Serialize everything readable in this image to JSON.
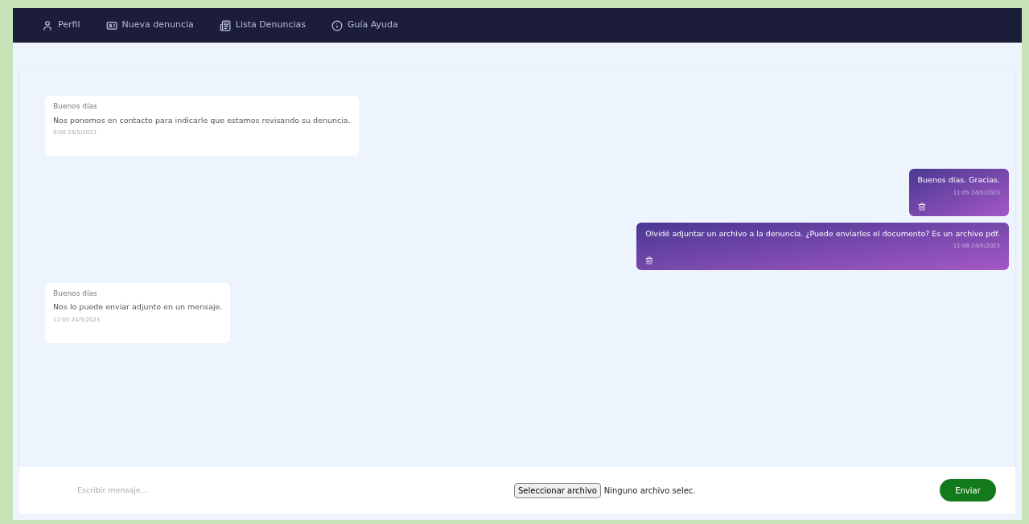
{
  "nav": [
    {
      "label": "Perfil"
    },
    {
      "label": "Nueva denuncia"
    },
    {
      "label": "Lista Denuncias"
    },
    {
      "label": "Guía Ayuda"
    }
  ],
  "messages": [
    {
      "kind": "incoming",
      "greeting": "Buenos días",
      "text": "Nos ponemos en contacto para indicarle que estamos revisando su denuncia.",
      "time": "9:00 24/5/2023"
    },
    {
      "kind": "outgoing",
      "text": "Buenos días. Gracias.",
      "time": "11:05 24/5/2023"
    },
    {
      "kind": "outgoing",
      "text": "Olvidé adjuntar un archivo a la denuncia. ¿Puede enviarles el documento? Es un archivo pdf.",
      "time": "11:08 24/5/2023"
    },
    {
      "kind": "incoming",
      "greeting": "Buenos días",
      "text": "Nos lo puede enviar adjunto en un mensaje.",
      "time": "12:00 24/5/2023"
    }
  ],
  "composer": {
    "placeholder": "Escribir mensaje...",
    "file_button": "Seleccionar archivo",
    "file_status": "Ninguno archivo selec.",
    "send": "Enviar"
  }
}
